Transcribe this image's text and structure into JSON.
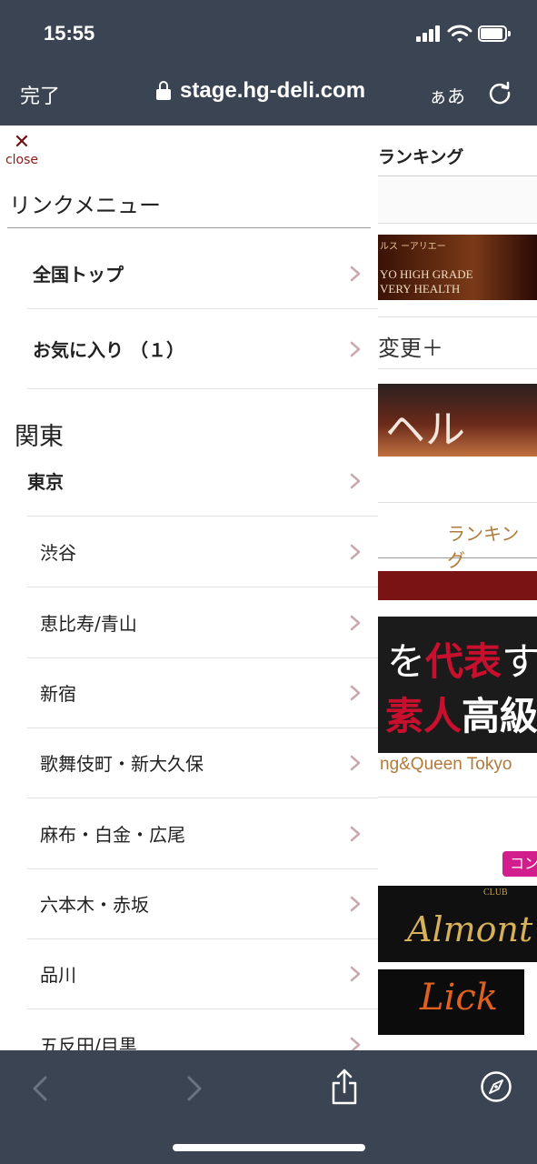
{
  "status_bar": {
    "time": "15:55"
  },
  "address_bar": {
    "done": "完了",
    "url": "stage.hg-deli.com",
    "text_size": "ぁあ"
  },
  "drawer": {
    "close_label": "close",
    "title": "リンクメニュー",
    "top_items": [
      {
        "label": "全国トップ"
      },
      {
        "label": "お気に入り （１）"
      }
    ],
    "region": "関東",
    "prefecture": "東京",
    "areas": [
      {
        "label": "渋谷"
      },
      {
        "label": "恵比寿/青山"
      },
      {
        "label": "新宿"
      },
      {
        "label": "歌舞伎町・新大久保"
      },
      {
        "label": "麻布・白金・広尾"
      },
      {
        "label": "六本木・赤坂"
      },
      {
        "label": "品川"
      },
      {
        "label": "五反田/目黒"
      }
    ]
  },
  "background_page": {
    "ranking_header": "ランキング",
    "banner1_line1": "ルス ーアリエー",
    "banner1_line2": "YO HIGH GRADE",
    "banner1_line3": "VERY HEALTH",
    "change_label": "変更＋",
    "banner2_text": "ヘル",
    "ranking_tab": "ランキング",
    "promo_line1a": "を",
    "promo_line1b": "代表",
    "promo_line1c": "す",
    "promo_line2a": "素人",
    "promo_line2b": "高級",
    "promo_caption": "ng&Queen Tokyo",
    "badge": "コン",
    "almont_club": "CLUB",
    "almont": "Almont",
    "lick": "Lick"
  },
  "colors": {
    "chrome": "#3b4452",
    "close": "#6b1010",
    "chevron": "#c9a9ad",
    "promo_red": "#c8102e",
    "badge": "#d21d8c"
  }
}
